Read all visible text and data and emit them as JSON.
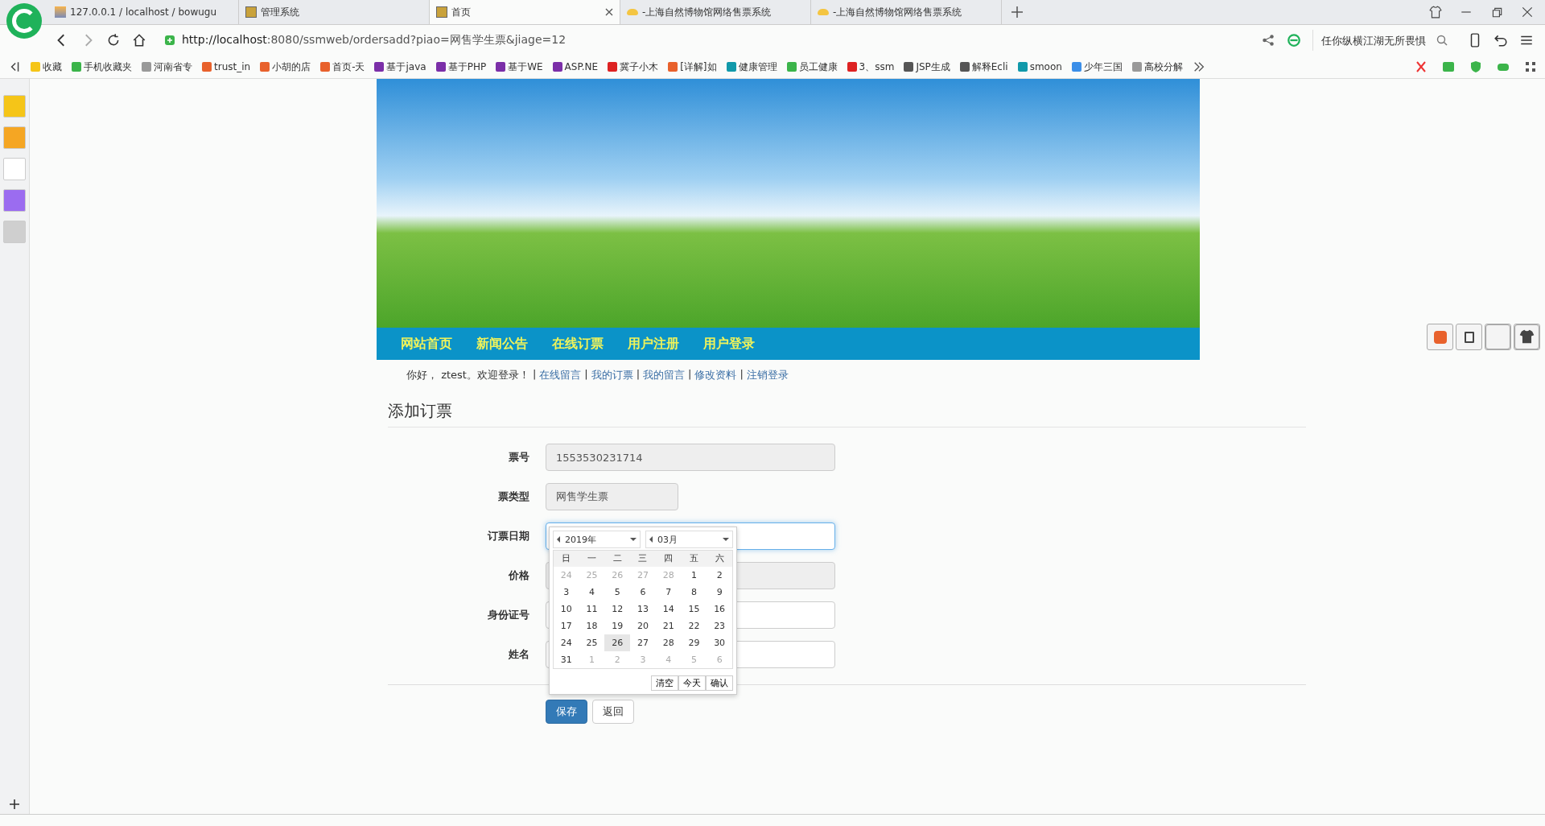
{
  "browser": {
    "tabs": [
      {
        "title": "127.0.0.1 / localhost / bowugu",
        "selected": false,
        "kind": "pma"
      },
      {
        "title": "管理系统",
        "selected": false,
        "kind": "page"
      },
      {
        "title": "首页",
        "selected": true,
        "kind": "page"
      },
      {
        "title": "-上海自然博物馆网络售票系统",
        "selected": false,
        "kind": "cloud"
      },
      {
        "title": "-上海自然博物馆网络售票系统",
        "selected": false,
        "kind": "cloud"
      }
    ],
    "url_host": "http://localhost",
    "url_rest": ":8080/ssmweb/ordersadd?piao=网售学生票&jiage=12",
    "search": {
      "placeholder": "任你纵横江湖无所畏惧"
    },
    "bookmarks": [
      "收藏",
      "手机收藏夹",
      "河南省专",
      "trust_in",
      "小胡的店",
      "首页-天",
      "基于java",
      "基于PHP",
      "基于WE",
      "ASP.NE",
      "冀子小木",
      "[详解]如",
      "健康管理",
      "员工健康",
      "3、ssm",
      "JSP生成",
      "解释Ecli",
      "smoon",
      "少年三国",
      "高校分解"
    ]
  },
  "page": {
    "nav": [
      "网站首页",
      "新闻公告",
      "在线订票",
      "用户注册",
      "用户登录"
    ],
    "greeting": "你好， ztest。欢迎登录！",
    "user_links": [
      "在线留言",
      "我的订票",
      "我的留言",
      "修改资料",
      "注销登录"
    ],
    "link_separator": "|",
    "form_title": "添加订票",
    "fields": [
      {
        "label": "票号",
        "value": "1553530231714",
        "readonly": true,
        "focused": false,
        "compact": false
      },
      {
        "label": "票类型",
        "value": "网售学生票",
        "readonly": true,
        "focused": false,
        "compact": true
      },
      {
        "label": "订票日期",
        "readonly": false,
        "focused": true,
        "compact": false
      },
      {
        "label": "价格",
        "readonly": true,
        "focused": false,
        "compact": false
      },
      {
        "label": "身份证号",
        "readonly": false,
        "focused": false,
        "compact": false
      },
      {
        "label": "姓名",
        "readonly": false,
        "focused": false,
        "compact": false
      }
    ],
    "buttons": [
      {
        "label": "保存",
        "kind": "primary"
      },
      {
        "label": "返回",
        "kind": "default"
      }
    ],
    "calendar": {
      "year": "2019年",
      "month": "03月",
      "weekdays": [
        "日",
        "一",
        "二",
        "三",
        "四",
        "五",
        "六"
      ],
      "days": [
        {
          "text": "24",
          "muted": true,
          "selected": false
        },
        {
          "text": "25",
          "muted": true,
          "selected": false
        },
        {
          "text": "26",
          "muted": true,
          "selected": false
        },
        {
          "text": "27",
          "muted": true,
          "selected": false
        },
        {
          "text": "28",
          "muted": true,
          "selected": false
        },
        {
          "text": "1",
          "muted": false,
          "selected": false
        },
        {
          "text": "2",
          "muted": false,
          "selected": false
        },
        {
          "text": "3",
          "muted": false,
          "selected": false
        },
        {
          "text": "4",
          "muted": false,
          "selected": false
        },
        {
          "text": "5",
          "muted": false,
          "selected": false
        },
        {
          "text": "6",
          "muted": false,
          "selected": false
        },
        {
          "text": "7",
          "muted": false,
          "selected": false
        },
        {
          "text": "8",
          "muted": false,
          "selected": false
        },
        {
          "text": "9",
          "muted": false,
          "selected": false
        },
        {
          "text": "10",
          "muted": false,
          "selected": false
        },
        {
          "text": "11",
          "muted": false,
          "selected": false
        },
        {
          "text": "12",
          "muted": false,
          "selected": false
        },
        {
          "text": "13",
          "muted": false,
          "selected": false
        },
        {
          "text": "14",
          "muted": false,
          "selected": false
        },
        {
          "text": "15",
          "muted": false,
          "selected": false
        },
        {
          "text": "16",
          "muted": false,
          "selected": false
        },
        {
          "text": "17",
          "muted": false,
          "selected": false
        },
        {
          "text": "18",
          "muted": false,
          "selected": false
        },
        {
          "text": "19",
          "muted": false,
          "selected": false
        },
        {
          "text": "20",
          "muted": false,
          "selected": false
        },
        {
          "text": "21",
          "muted": false,
          "selected": false
        },
        {
          "text": "22",
          "muted": false,
          "selected": false
        },
        {
          "text": "23",
          "muted": false,
          "selected": false
        },
        {
          "text": "24",
          "muted": false,
          "selected": false
        },
        {
          "text": "25",
          "muted": false,
          "selected": false
        },
        {
          "text": "26",
          "muted": false,
          "selected": true
        },
        {
          "text": "27",
          "muted": false,
          "selected": false
        },
        {
          "text": "28",
          "muted": false,
          "selected": false
        },
        {
          "text": "29",
          "muted": false,
          "selected": false
        },
        {
          "text": "30",
          "muted": false,
          "selected": false
        },
        {
          "text": "31",
          "muted": false,
          "selected": false
        },
        {
          "text": "1",
          "muted": true,
          "selected": false
        },
        {
          "text": "2",
          "muted": true,
          "selected": false
        },
        {
          "text": "3",
          "muted": true,
          "selected": false
        },
        {
          "text": "4",
          "muted": true,
          "selected": false
        },
        {
          "text": "5",
          "muted": true,
          "selected": false
        },
        {
          "text": "6",
          "muted": true,
          "selected": false
        }
      ],
      "actions": [
        "清空",
        "今天",
        "确认"
      ]
    }
  }
}
